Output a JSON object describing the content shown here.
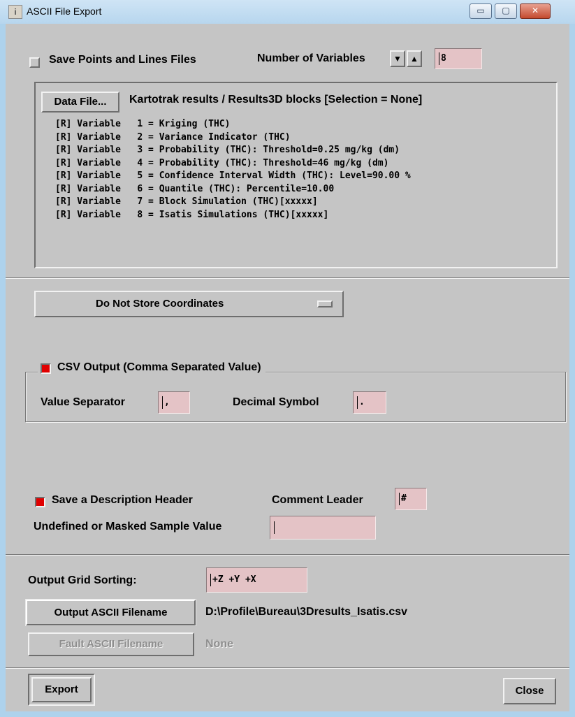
{
  "window": {
    "title": "ASCII File Export",
    "minimize_glyph": "▭",
    "maximize_glyph": "▢",
    "close_glyph": "✕"
  },
  "top": {
    "save_points_label": "Save Points and Lines Files",
    "save_points_checked": false,
    "num_vars_label": "Number of Variables",
    "down_glyph": "▼",
    "up_glyph": "▲",
    "num_vars_value": "8"
  },
  "data_panel": {
    "data_file_button": "Data File...",
    "source_label": "Kartotrak results / Results3D blocks [Selection = None]",
    "variables": [
      "[R] Variable   1 = Kriging (THC)",
      "[R] Variable   2 = Variance Indicator (THC)",
      "[R] Variable   3 = Probability (THC): Threshold=0.25 mg/kg (dm)",
      "[R] Variable   4 = Probability (THC): Threshold=46 mg/kg (dm)",
      "[R] Variable   5 = Confidence Interval Width (THC): Level=90.00 %",
      "[R] Variable   6 = Quantile (THC): Percentile=10.00",
      "[R] Variable   7 = Block Simulation (THC)[xxxxx]",
      "[R] Variable   8 = Isatis Simulations (THC)[xxxxx]"
    ]
  },
  "coordinates": {
    "option_label": "Do Not Store Coordinates"
  },
  "csv": {
    "group_label": "CSV Output (Comma Separated Value)",
    "checked": true,
    "value_separator_label": "Value Separator",
    "value_separator_value": ",",
    "decimal_symbol_label": "Decimal Symbol",
    "decimal_symbol_value": "."
  },
  "header": {
    "save_header_label": "Save a Description Header",
    "checked": true,
    "comment_leader_label": "Comment Leader",
    "comment_leader_value": "#",
    "undefined_label": "Undefined or Masked Sample Value",
    "undefined_value": ""
  },
  "output": {
    "grid_sorting_label": "Output Grid Sorting:",
    "grid_sorting_value": "+Z +Y +X",
    "ascii_filename_button": "Output ASCII Filename",
    "ascii_filename_value": "D:\\Profile\\Bureau\\3Dresults_Isatis.csv",
    "fault_filename_button": "Fault ASCII Filename",
    "fault_filename_value": "None"
  },
  "footer": {
    "export_button": "Export",
    "close_button": "Close"
  },
  "colors": {
    "window_frame": "#aed2ec",
    "client_bg": "#c5c5c5",
    "field_bg": "#e4c3c6",
    "checkbox_on": "#e00000"
  }
}
